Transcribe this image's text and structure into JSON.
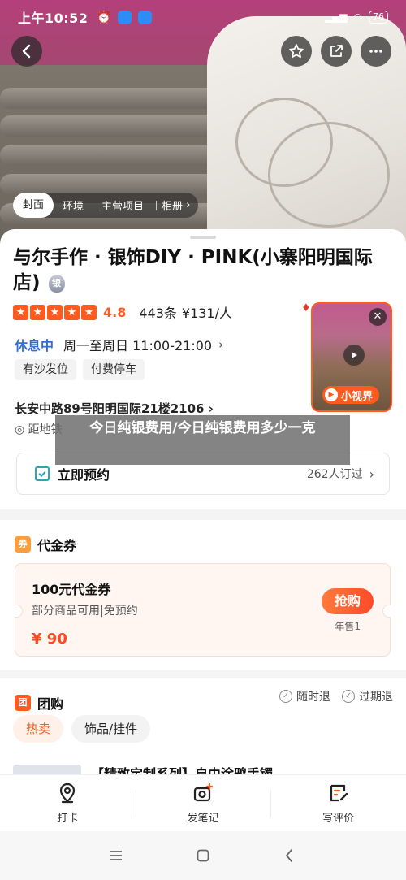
{
  "status_bar": {
    "time": "上午10:52",
    "battery": "76"
  },
  "photo_tabs": [
    "封面",
    "环境",
    "主营项目",
    "相册"
  ],
  "shop": {
    "name": "与尔手作 · 银饰DIY · PINK(小寨阳明国际店)",
    "badge": "银",
    "score": "4.8",
    "reviews": "443条",
    "price": "¥131/人",
    "hours_status": "休息中",
    "hours": "周一至周日 11:00-21:00",
    "tags": [
      "有沙发位",
      "付费停车"
    ],
    "address": "长安中路89号阳明国际21楼2106",
    "distance": "距地铁"
  },
  "mini_video": {
    "label": "小视界"
  },
  "booking": {
    "label": "立即预约",
    "count": "262人订过"
  },
  "overlay_title": "今日纯银费用/今日纯银费用多少一克",
  "coupon_section": {
    "title": "代金券",
    "icon": "券",
    "coupon": {
      "title": "100元代金券",
      "desc": "部分商品可用|免预约",
      "price": "¥ 90",
      "button": "抢购",
      "sold": "年售1"
    }
  },
  "group_section": {
    "title": "团购",
    "icon": "团",
    "guarantees": [
      "随时退",
      "过期退"
    ],
    "tabs": [
      "热卖",
      "饰品/挂件"
    ],
    "peek_title": "【精致定制系列】自由涂鸦手镯"
  },
  "actions": [
    "打卡",
    "发笔记",
    "写评价"
  ],
  "colors": {
    "accent": "#ff5a1f",
    "link_blue": "#2f6fd6"
  }
}
